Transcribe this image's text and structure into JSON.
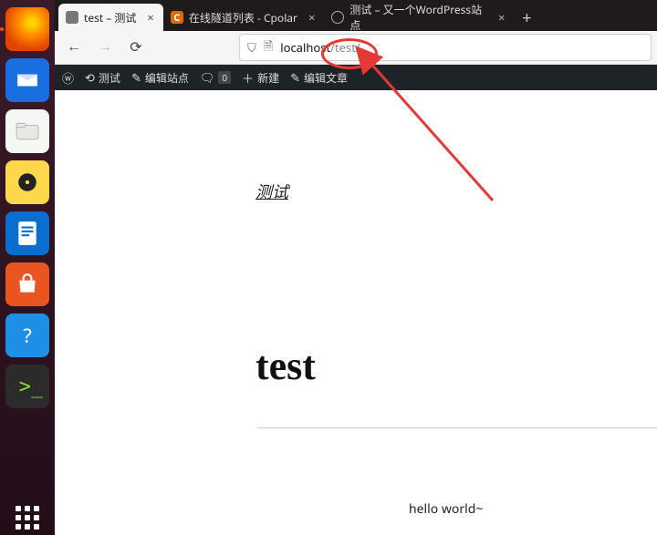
{
  "dock": {
    "items": [
      {
        "name": "firefox",
        "active": true
      },
      {
        "name": "thunderbird"
      },
      {
        "name": "files"
      },
      {
        "name": "rhythmbox"
      },
      {
        "name": "libreoffice"
      },
      {
        "name": "software"
      },
      {
        "name": "help"
      },
      {
        "name": "terminal"
      }
    ]
  },
  "tabs": [
    {
      "label": "test – 测试",
      "active": true,
      "favicon": "globe"
    },
    {
      "label": "在线隧道列表 - Cpolar",
      "favicon": "cpolar",
      "favicon_letter": "C"
    },
    {
      "label": "测试 – 又一个WordPress站点",
      "favicon": "wp"
    }
  ],
  "newtab_plus": "+",
  "toolbar": {
    "back": "←",
    "forward": "→",
    "reload": "⟳",
    "shield": "⛉",
    "lock": "🗎"
  },
  "url": {
    "host": "localhost",
    "path": "/test/"
  },
  "wpbar": {
    "logo": "ⓦ",
    "dash": "⟲",
    "site": "测试",
    "customize": "✎",
    "customize_label": "编辑站点",
    "comments": "🗨",
    "comments_count": "0",
    "new": "＋",
    "new_label": "新建",
    "edit": "✎",
    "edit_label": "编辑文章"
  },
  "content": {
    "site_title": "测试",
    "post_title": "test",
    "post_body": "hello world~"
  }
}
